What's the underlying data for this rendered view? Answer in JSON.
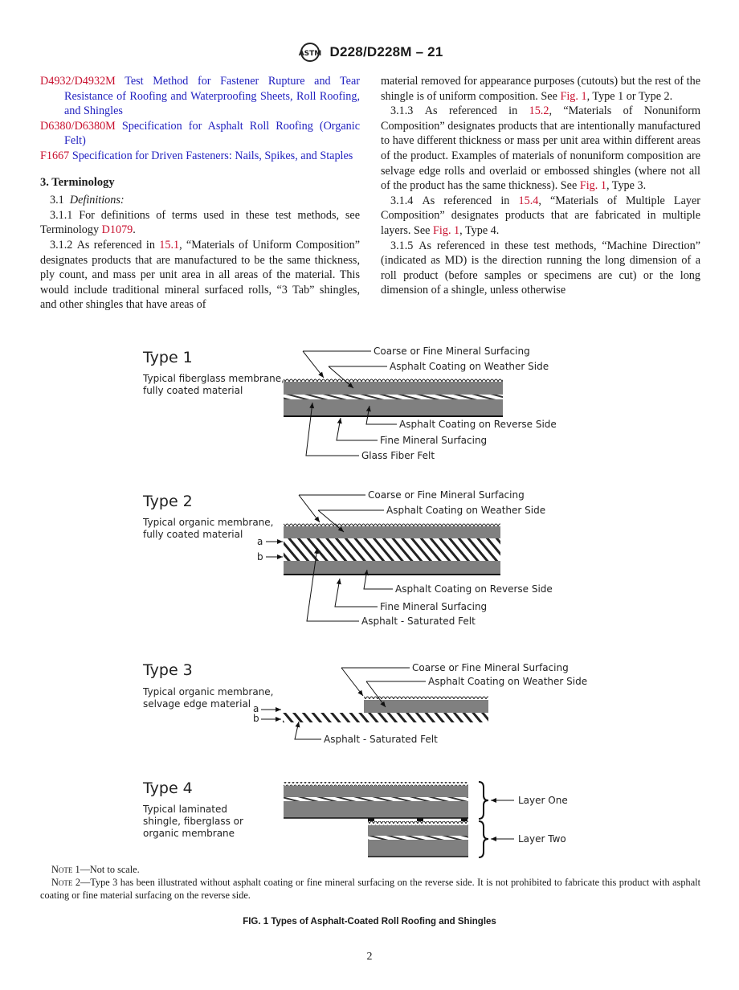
{
  "header": {
    "logo_icon": "astm-logo-icon",
    "designation": "D228/D228M – 21"
  },
  "references": [
    {
      "code": "D4932/D4932M",
      "title": "Test Method for Fastener Rupture and Tear Resistance of Roofing and Waterproofing Sheets, Roll Roofing, and Shingles"
    },
    {
      "code": "D6380/D6380M",
      "title": "Specification for Asphalt Roll Roofing (Organic Felt)"
    },
    {
      "code": "F1667",
      "title": "Specification for Driven Fasteners: Nails, Spikes, and Staples"
    }
  ],
  "section": {
    "heading": "3. Terminology",
    "s31_num": "3.1",
    "s31_title": "Definitions:",
    "s311": {
      "num": "3.1.1",
      "text_before": "For definitions of terms used in these test methods, see Terminology ",
      "link": "D1079",
      "text_after": "."
    },
    "s312": {
      "num": "3.1.2",
      "text_before": "As referenced in ",
      "link": "15.1",
      "text_mid": ", “Materials of Uniform Composition” designates products that are manufactured to be the same thickness, ply count, and mass per unit area in all areas of the material. This would include traditional mineral surfaced rolls, “3 Tab” shingles, and other shingles that have areas of material removed for appearance purposes (cutouts) but the rest of the shingle is of uniform composition. See ",
      "fig_link": "Fig. 1",
      "text_after": ", Type 1 or Type 2."
    },
    "s313": {
      "num": "3.1.3",
      "text_before": "As referenced in ",
      "link": "15.2",
      "text_mid": ", “Materials of Nonuniform Composition” designates products that are intentionally manufactured to have different thickness or mass per unit area within different areas of the product. Examples of materials of nonuniform composition are selvage edge rolls and overlaid or embossed shingles (where not all of the product has the same thickness). See ",
      "fig_link": "Fig. 1",
      "text_after": ", Type 3."
    },
    "s314": {
      "num": "3.1.4",
      "text_before": "As referenced in ",
      "link": "15.4",
      "text_mid": ", “Materials of Multiple Layer Composition” designates products that are fabricated in multiple layers. See ",
      "fig_link": "Fig. 1",
      "text_after": ", Type 4."
    },
    "s315": {
      "num": "3.1.5",
      "text": "As referenced in these test methods, “Machine Direction” (indicated as MD) is the direction running the long dimension of a roll product (before samples or specimens are cut) or the long dimension of a shingle, unless otherwise"
    }
  },
  "figure": {
    "type1": {
      "title": "Type 1",
      "desc": [
        "Typical fiberglass membrane,",
        "fully coated material"
      ],
      "labels": [
        "Coarse or Fine Mineral Surfacing",
        "Asphalt Coating on Weather Side",
        "Asphalt Coating on Reverse Side",
        "Fine Mineral Surfacing",
        "Glass Fiber Felt"
      ]
    },
    "type2": {
      "title": "Type 2",
      "desc": [
        "Typical organic membrane,",
        "fully coated material"
      ],
      "markers": [
        "a",
        "b"
      ],
      "labels": [
        "Coarse or Fine Mineral Surfacing",
        "Asphalt Coating on Weather Side",
        "Asphalt Coating on Reverse Side",
        "Fine Mineral Surfacing",
        "Asphalt - Saturated Felt"
      ]
    },
    "type3": {
      "title": "Type 3",
      "desc": [
        "Typical organic membrane,",
        "selvage edge material"
      ],
      "markers": [
        "a",
        "b"
      ],
      "labels": [
        "Coarse or Fine Mineral Surfacing",
        "Asphalt Coating on Weather Side",
        "Asphalt - Saturated Felt"
      ]
    },
    "type4": {
      "title": "Type 4",
      "desc": [
        "Typical laminated",
        "shingle, fiberglass or",
        "organic membrane"
      ],
      "labels": [
        "Layer One",
        "Layer Two"
      ]
    },
    "colors": {
      "asphalt": "#808080",
      "line": "#111111",
      "link_red": "#c8102e",
      "link_blue": "#1f1fbf"
    }
  },
  "notes": {
    "note1_label": "Note 1",
    "note1_text": "—Not to scale.",
    "note2_label": "Note 2",
    "note2_text": "—Type 3 has been illustrated without asphalt coating or fine mineral surfacing on the reverse side. It is not prohibited to fabricate this product with asphalt coating or fine material surfacing on the reverse side."
  },
  "caption": "FIG. 1 Types of Asphalt-Coated Roll Roofing and Shingles",
  "page_number": "2"
}
